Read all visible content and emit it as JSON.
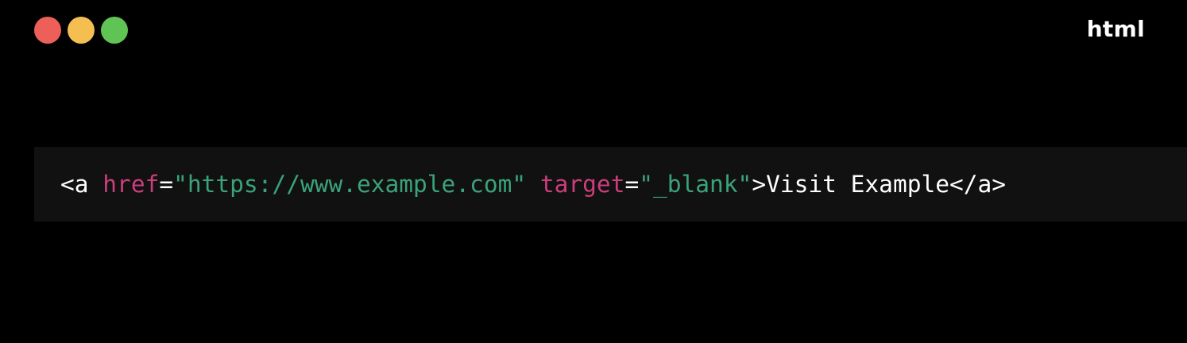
{
  "window": {
    "controls": [
      {
        "name": "close",
        "color": "#ec6059"
      },
      {
        "name": "minimize",
        "color": "#f4be50"
      },
      {
        "name": "zoom",
        "color": "#60c454"
      }
    ],
    "language": "html"
  },
  "code": {
    "tokens": [
      {
        "text": "<",
        "kind": "punct"
      },
      {
        "text": "a",
        "kind": "tag"
      },
      {
        "text": " ",
        "kind": "text"
      },
      {
        "text": "href",
        "kind": "attr"
      },
      {
        "text": "=",
        "kind": "punct"
      },
      {
        "text": "\"https://www.example.com\"",
        "kind": "str"
      },
      {
        "text": " ",
        "kind": "text"
      },
      {
        "text": "target",
        "kind": "attr"
      },
      {
        "text": "=",
        "kind": "punct"
      },
      {
        "text": "\"_blank\"",
        "kind": "str"
      },
      {
        "text": ">",
        "kind": "punct"
      },
      {
        "text": "Visit Example",
        "kind": "text"
      },
      {
        "text": "</",
        "kind": "punct"
      },
      {
        "text": "a",
        "kind": "tag"
      },
      {
        "text": ">",
        "kind": "punct"
      }
    ]
  }
}
